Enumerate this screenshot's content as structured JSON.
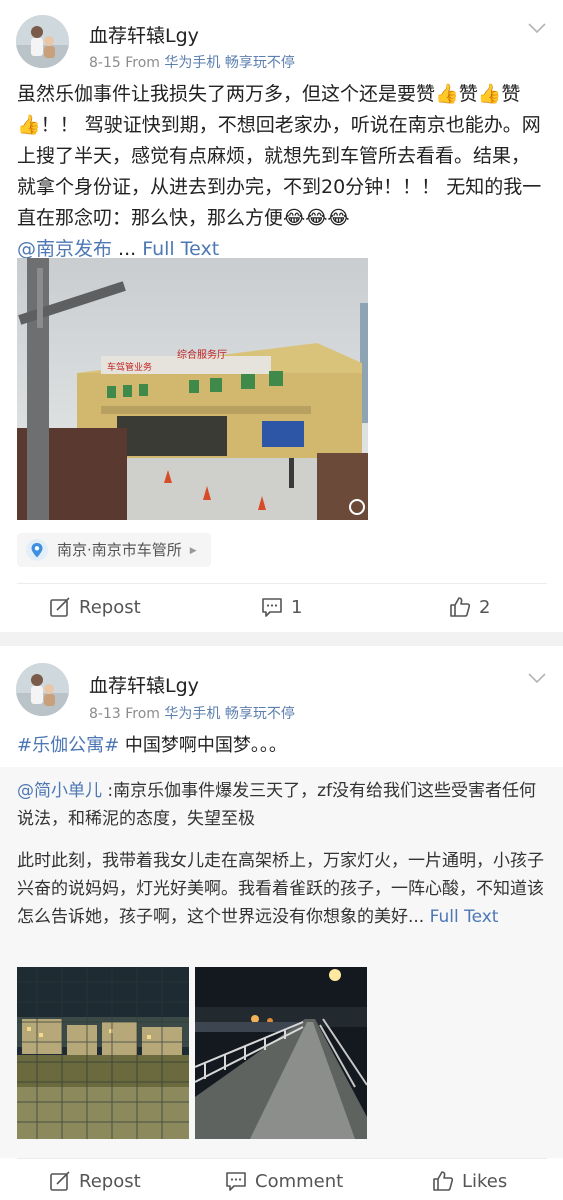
{
  "post1": {
    "author": "血荐轩辕Lgy",
    "date": "8-15",
    "from_label": "From",
    "source": "华为手机 畅享玩不停",
    "text_line1": "虽然乐伽事件让我损失了两万多，但这个还是要赞",
    "text_zan1": "赞",
    "text_zan2": "赞",
    "text_line2_rest": "！！ 驾驶证快到期，不想回老家办，听说在南京也能办。网上搜了半天，感觉有点麻烦，就想先到车管所去看看。结果，就拿个身份证，从进去到办完，不到20分钟！！！ 无知的我一直在那念叨：那么快，那么方便",
    "mention": "@南京发布",
    "ellipsis": " ... ",
    "full_text": "Full Text",
    "photo_sign": "车驾管业务",
    "photo_sign2": "综合服务厅",
    "location": "南京·南京市车管所",
    "repost": "Repost",
    "comments": "1",
    "likes": "2"
  },
  "post2": {
    "author": "血荐轩辕Lgy",
    "date": "8-13",
    "from_label": "From",
    "source": "华为手机 畅享玩不停",
    "hashtag": "#乐伽公寓#",
    "text": " 中国梦啊中国梦。。。",
    "quote_author": "@简小单儿",
    "quote_p1": " :南京乐伽事件爆发三天了，zf没有给我们这些受害者任何说法，和稀泥的态度，失望至极",
    "quote_p2": "此时此刻，我带着我女儿走在高架桥上，万家灯火，一片通明，小孩子兴奋的说妈妈，灯光好美啊。我看着雀跃的孩子，一阵心酸，不知道该怎么告诉她，孩子啊，这个世界远没有你想象的美好...",
    "full_text": " Full Text",
    "repost": "Repost",
    "comment": "Comment",
    "likes": "Likes"
  }
}
